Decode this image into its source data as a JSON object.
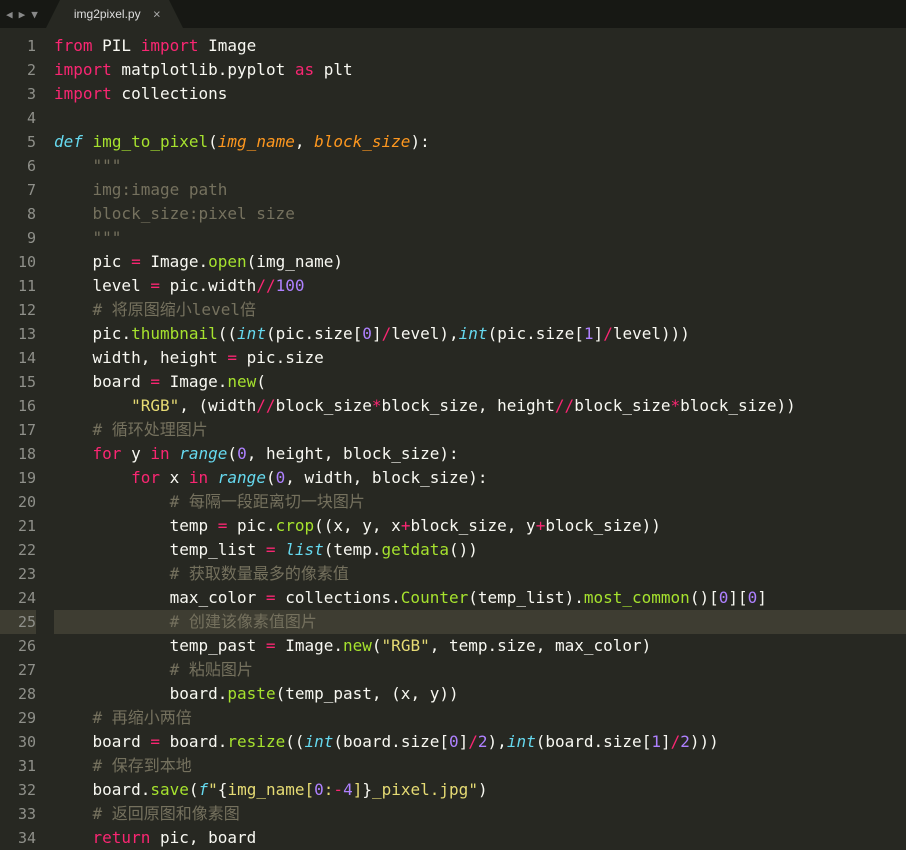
{
  "tab": {
    "name": "img2pixel.py",
    "close": "×"
  },
  "nav": {
    "back": "◀",
    "fwd": "▶",
    "down": "▼"
  },
  "lines": [
    [
      [
        "kw",
        "from"
      ],
      [
        "pln",
        " PIL "
      ],
      [
        "kw",
        "import"
      ],
      [
        "pln",
        " Image"
      ]
    ],
    [
      [
        "kw",
        "import"
      ],
      [
        "pln",
        " matplotlib"
      ],
      [
        "dot",
        "."
      ],
      [
        "pln",
        "pyplot "
      ],
      [
        "kw",
        "as"
      ],
      [
        "pln",
        " plt"
      ]
    ],
    [
      [
        "kw",
        "import"
      ],
      [
        "pln",
        " collections"
      ]
    ],
    [],
    [
      [
        "kw2",
        "def"
      ],
      [
        "pln",
        " "
      ],
      [
        "fn",
        "img_to_pixel"
      ],
      [
        "pln",
        "("
      ],
      [
        "prm",
        "img_name"
      ],
      [
        "pln",
        ", "
      ],
      [
        "prm",
        "block_size"
      ],
      [
        "pln",
        "):"
      ]
    ],
    [
      [
        "pln",
        "    "
      ],
      [
        "cmt",
        "\"\"\""
      ]
    ],
    [
      [
        "pln",
        "    "
      ],
      [
        "cmt",
        "img:image path"
      ]
    ],
    [
      [
        "pln",
        "    "
      ],
      [
        "cmt",
        "block_size:pixel size"
      ]
    ],
    [
      [
        "pln",
        "    "
      ],
      [
        "cmt",
        "\"\"\""
      ]
    ],
    [
      [
        "pln",
        "    pic "
      ],
      [
        "kw",
        "="
      ],
      [
        "pln",
        " Image"
      ],
      [
        "dot",
        "."
      ],
      [
        "fn",
        "open"
      ],
      [
        "pln",
        "(img_name)"
      ]
    ],
    [
      [
        "pln",
        "    level "
      ],
      [
        "kw",
        "="
      ],
      [
        "pln",
        " pic"
      ],
      [
        "dot",
        "."
      ],
      [
        "pln",
        "width"
      ],
      [
        "kw",
        "//"
      ],
      [
        "num",
        "100"
      ]
    ],
    [
      [
        "pln",
        "    "
      ],
      [
        "cmt",
        "# 将原图缩小level倍"
      ]
    ],
    [
      [
        "pln",
        "    pic"
      ],
      [
        "dot",
        "."
      ],
      [
        "fn",
        "thumbnail"
      ],
      [
        "pln",
        "(("
      ],
      [
        "kw2",
        "int"
      ],
      [
        "pln",
        "(pic"
      ],
      [
        "dot",
        "."
      ],
      [
        "pln",
        "size["
      ],
      [
        "num",
        "0"
      ],
      [
        "pln",
        "]"
      ],
      [
        "kw",
        "/"
      ],
      [
        "pln",
        "level),"
      ],
      [
        "kw2",
        "int"
      ],
      [
        "pln",
        "(pic"
      ],
      [
        "dot",
        "."
      ],
      [
        "pln",
        "size["
      ],
      [
        "num",
        "1"
      ],
      [
        "pln",
        "]"
      ],
      [
        "kw",
        "/"
      ],
      [
        "pln",
        "level)))"
      ]
    ],
    [
      [
        "pln",
        "    width, height "
      ],
      [
        "kw",
        "="
      ],
      [
        "pln",
        " pic"
      ],
      [
        "dot",
        "."
      ],
      [
        "pln",
        "size"
      ]
    ],
    [
      [
        "pln",
        "    board "
      ],
      [
        "kw",
        "="
      ],
      [
        "pln",
        " Image"
      ],
      [
        "dot",
        "."
      ],
      [
        "fn",
        "new"
      ],
      [
        "pln",
        "("
      ]
    ],
    [
      [
        "pln",
        "        "
      ],
      [
        "str",
        "\"RGB\""
      ],
      [
        "pln",
        ", (width"
      ],
      [
        "kw",
        "//"
      ],
      [
        "pln",
        "block_size"
      ],
      [
        "kw",
        "*"
      ],
      [
        "pln",
        "block_size, height"
      ],
      [
        "kw",
        "//"
      ],
      [
        "pln",
        "block_size"
      ],
      [
        "kw",
        "*"
      ],
      [
        "pln",
        "block_size))"
      ]
    ],
    [
      [
        "pln",
        "    "
      ],
      [
        "cmt",
        "# 循环处理图片"
      ]
    ],
    [
      [
        "pln",
        "    "
      ],
      [
        "kw",
        "for"
      ],
      [
        "pln",
        " y "
      ],
      [
        "kw",
        "in"
      ],
      [
        "pln",
        " "
      ],
      [
        "kw2",
        "range"
      ],
      [
        "pln",
        "("
      ],
      [
        "num",
        "0"
      ],
      [
        "pln",
        ", height, block_size):"
      ]
    ],
    [
      [
        "pln",
        "        "
      ],
      [
        "kw",
        "for"
      ],
      [
        "pln",
        " x "
      ],
      [
        "kw",
        "in"
      ],
      [
        "pln",
        " "
      ],
      [
        "kw2",
        "range"
      ],
      [
        "pln",
        "("
      ],
      [
        "num",
        "0"
      ],
      [
        "pln",
        ", width, block_size):"
      ]
    ],
    [
      [
        "pln",
        "            "
      ],
      [
        "cmt",
        "# 每隔一段距离切一块图片"
      ]
    ],
    [
      [
        "pln",
        "            temp "
      ],
      [
        "kw",
        "="
      ],
      [
        "pln",
        " pic"
      ],
      [
        "dot",
        "."
      ],
      [
        "fn",
        "crop"
      ],
      [
        "pln",
        "((x, y, x"
      ],
      [
        "kw",
        "+"
      ],
      [
        "pln",
        "block_size, y"
      ],
      [
        "kw",
        "+"
      ],
      [
        "pln",
        "block_size))"
      ]
    ],
    [
      [
        "pln",
        "            temp_list "
      ],
      [
        "kw",
        "="
      ],
      [
        "pln",
        " "
      ],
      [
        "kw2",
        "list"
      ],
      [
        "pln",
        "(temp"
      ],
      [
        "dot",
        "."
      ],
      [
        "fn",
        "getdata"
      ],
      [
        "pln",
        "())"
      ]
    ],
    [
      [
        "pln",
        "            "
      ],
      [
        "cmt",
        "# 获取数量最多的像素值"
      ]
    ],
    [
      [
        "pln",
        "            max_color "
      ],
      [
        "kw",
        "="
      ],
      [
        "pln",
        " collections"
      ],
      [
        "dot",
        "."
      ],
      [
        "fn",
        "Counter"
      ],
      [
        "pln",
        "(temp_list)"
      ],
      [
        "dot",
        "."
      ],
      [
        "fn",
        "most_common"
      ],
      [
        "pln",
        "()["
      ],
      [
        "num",
        "0"
      ],
      [
        "pln",
        "]["
      ],
      [
        "num",
        "0"
      ],
      [
        "pln",
        "]"
      ]
    ],
    [
      [
        "pln",
        "            "
      ],
      [
        "cmt",
        "# 创建该像素值图片"
      ]
    ],
    [
      [
        "pln",
        "            temp_past "
      ],
      [
        "kw",
        "="
      ],
      [
        "pln",
        " Image"
      ],
      [
        "dot",
        "."
      ],
      [
        "fn",
        "new"
      ],
      [
        "pln",
        "("
      ],
      [
        "str",
        "\"RGB\""
      ],
      [
        "pln",
        ", temp"
      ],
      [
        "dot",
        "."
      ],
      [
        "pln",
        "size, max_color)"
      ]
    ],
    [
      [
        "pln",
        "            "
      ],
      [
        "cmt",
        "# 粘贴图片"
      ]
    ],
    [
      [
        "pln",
        "            board"
      ],
      [
        "dot",
        "."
      ],
      [
        "fn",
        "paste"
      ],
      [
        "pln",
        "(temp_past, (x, y))"
      ]
    ],
    [
      [
        "pln",
        "    "
      ],
      [
        "cmt",
        "# 再缩小两倍"
      ]
    ],
    [
      [
        "pln",
        "    board "
      ],
      [
        "kw",
        "="
      ],
      [
        "pln",
        " board"
      ],
      [
        "dot",
        "."
      ],
      [
        "fn",
        "resize"
      ],
      [
        "pln",
        "(("
      ],
      [
        "kw2",
        "int"
      ],
      [
        "pln",
        "(board"
      ],
      [
        "dot",
        "."
      ],
      [
        "pln",
        "size["
      ],
      [
        "num",
        "0"
      ],
      [
        "pln",
        "]"
      ],
      [
        "kw",
        "/"
      ],
      [
        "num",
        "2"
      ],
      [
        "pln",
        "),"
      ],
      [
        "kw2",
        "int"
      ],
      [
        "pln",
        "(board"
      ],
      [
        "dot",
        "."
      ],
      [
        "pln",
        "size["
      ],
      [
        "num",
        "1"
      ],
      [
        "pln",
        "]"
      ],
      [
        "kw",
        "/"
      ],
      [
        "num",
        "2"
      ],
      [
        "pln",
        ")))"
      ]
    ],
    [
      [
        "pln",
        "    "
      ],
      [
        "cmt",
        "# 保存到本地"
      ]
    ],
    [
      [
        "pln",
        "    board"
      ],
      [
        "dot",
        "."
      ],
      [
        "fn",
        "save"
      ],
      [
        "pln",
        "("
      ],
      [
        "kw2",
        "f"
      ],
      [
        "str",
        "\""
      ],
      [
        "pln",
        "{"
      ],
      [
        "str",
        "img_name["
      ],
      [
        "num",
        "0"
      ],
      [
        "str",
        ":"
      ],
      [
        "kw",
        "-"
      ],
      [
        "num",
        "4"
      ],
      [
        "str",
        "]"
      ],
      [
        "pln",
        "}"
      ],
      [
        "str",
        "_pixel.jpg\""
      ],
      [
        "pln",
        ")"
      ]
    ],
    [
      [
        "pln",
        "    "
      ],
      [
        "cmt",
        "# 返回原图和像素图"
      ]
    ],
    [
      [
        "pln",
        "    "
      ],
      [
        "kw",
        "return"
      ],
      [
        "pln",
        " pic, board"
      ]
    ]
  ],
  "highlight_line": 25
}
